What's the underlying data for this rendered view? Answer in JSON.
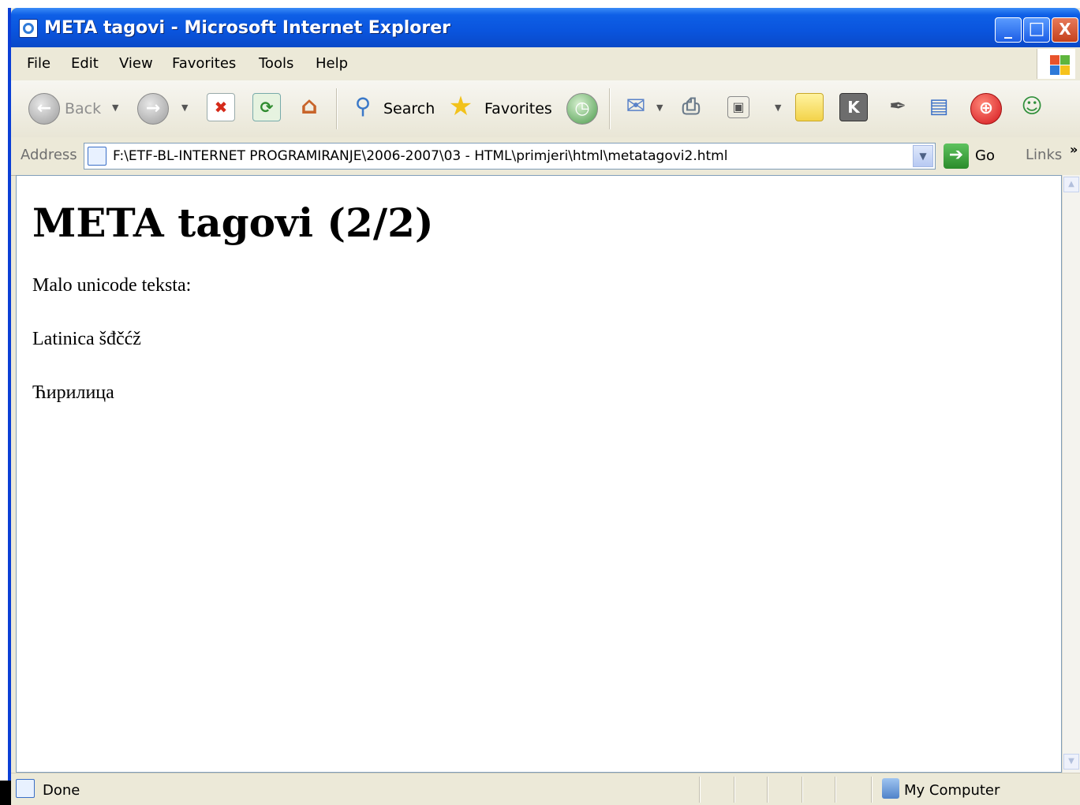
{
  "window": {
    "title": "META tagovi - Microsoft Internet Explorer",
    "controls": {
      "minimize": "_",
      "maximize": "□",
      "close": "X"
    }
  },
  "menu": [
    "File",
    "Edit",
    "View",
    "Favorites",
    "Tools",
    "Help"
  ],
  "toolbar": {
    "back_label": "Back",
    "search_label": "Search",
    "favorites_label": "Favorites",
    "icons": [
      "back-icon",
      "forward-icon",
      "stop-icon",
      "refresh-icon",
      "home-icon",
      "search-icon",
      "favorites-star-icon",
      "history-icon",
      "mail-icon",
      "print-icon",
      "edit-icon",
      "note-icon",
      "k-icon",
      "pen-icon",
      "research-icon",
      "messenger-alert-icon",
      "messenger-icon"
    ]
  },
  "address": {
    "label": "Address",
    "value": "F:\\ETF-BL-INTERNET PROGRAMIRANJE\\2006-2007\\03 - HTML\\primjeri\\html\\metatagovi2.html",
    "go_label": "Go",
    "links_label": "Links",
    "more": "»"
  },
  "page": {
    "heading": "META tagovi (2/2)",
    "paragraphs": [
      "Malo unicode teksta:",
      "Latinica šđčćž",
      "Ћирилица"
    ]
  },
  "status": {
    "text": "Done",
    "zone": "My Computer"
  },
  "colors": {
    "title_bar": "#0a54dd",
    "chrome": "#ece9d8",
    "content_bg": "#ffffff"
  }
}
